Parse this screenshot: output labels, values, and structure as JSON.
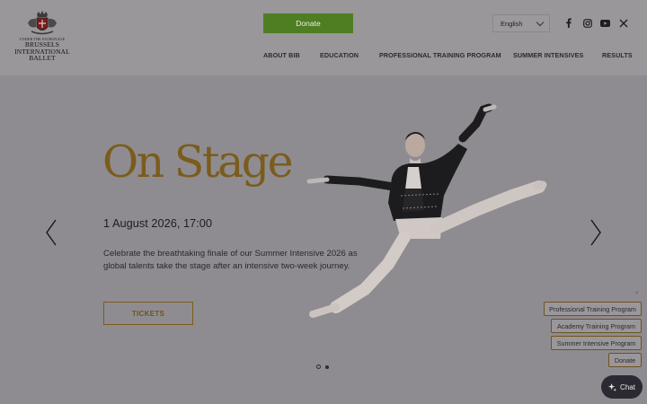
{
  "header": {
    "logo": {
      "small_line": "UNDER THE PATRONAGE",
      "line1": "BRUSSELS",
      "line2": "INTERNATIONAL",
      "line3": "BALLET"
    },
    "donate_label": "Donate",
    "language": "English",
    "social_icons": [
      "facebook-icon",
      "instagram-icon",
      "youtube-icon",
      "x-icon"
    ],
    "nav": [
      "ABOUT BIB",
      "EDUCATION",
      "PROFESSIONAL TRAINING PROGRAM",
      "SUMMER INTENSIVES",
      "RESULTS"
    ]
  },
  "hero": {
    "title": "On Stage",
    "date": "1 August 2026, 17:00",
    "description": "Celebrate the breathtaking finale of our Summer Intensive 2026 as global talents take the stage after an intensive two-week journey.",
    "tickets_label": "TICKETS",
    "slide_count": 2,
    "active_slide": 1
  },
  "quick_links": {
    "close": "×",
    "items": [
      "Professional Training Program",
      "Academy Training Program",
      "Summer Intensive Program",
      "Donate"
    ]
  },
  "chat": {
    "label": "Chat"
  },
  "colors": {
    "overlay": "#8f8c91",
    "header": "#999799",
    "accent_gold": "#7b5c1c",
    "donate_green": "#4f7e22",
    "chat_bg": "#2b2a33"
  }
}
